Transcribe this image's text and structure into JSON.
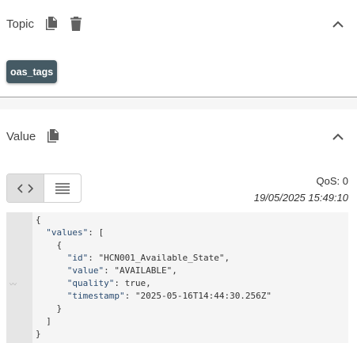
{
  "topic": {
    "title": "Topic",
    "chip_label": "oas_tags"
  },
  "value": {
    "title": "Value",
    "qos_text": "QoS: 0",
    "timestamp": "19/05/2025 15:49:10"
  },
  "icons": {
    "copy": "copy-icon",
    "delete": "trash-icon",
    "collapse": "chevron-up-icon",
    "code_view": "code-icon",
    "list_view": "list-icon",
    "gutter_mark": "sparkline-icon"
  },
  "payload": {
    "open_brace": "{",
    "values_key": "\"values\"",
    "values_sep": ": [",
    "item_open": "{",
    "item_close": "}",
    "array_close": "]",
    "close_brace": "}",
    "fields": [
      {
        "key": "\"id\"",
        "sep": ": ",
        "value": "\"HCN001_Available_State\"",
        "tail": ","
      },
      {
        "key": "\"value\"",
        "sep": ": ",
        "value": "\"AVAILABLE\"",
        "tail": ","
      },
      {
        "key": "\"quality\"",
        "sep": ": ",
        "value": "true",
        "tail": ","
      },
      {
        "key": "\"timestamp\"",
        "sep": ": ",
        "value": "\"2025-05-16T14:44:30.256Z\"",
        "tail": ""
      }
    ]
  },
  "colors": {
    "chip_bg": "#455a64",
    "gutter_bg": "#e6e6e6",
    "code_bg": "#f5f5f5",
    "key_color": "#2a4b70"
  }
}
